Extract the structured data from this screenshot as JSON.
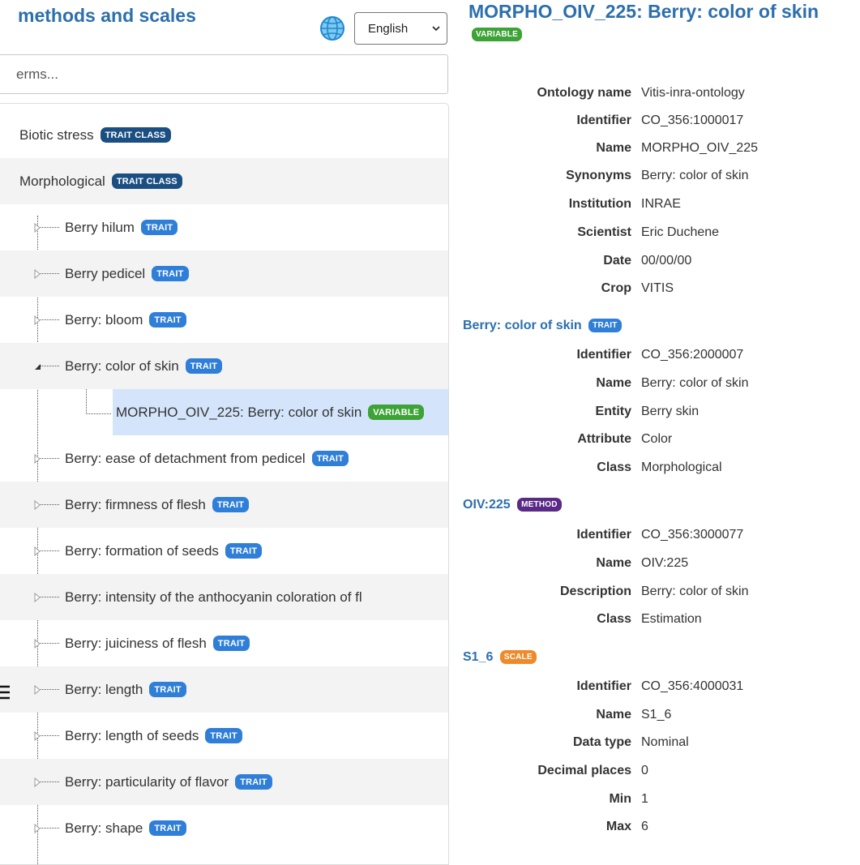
{
  "left": {
    "title": "methods and scales",
    "language": "English",
    "search_placeholder": "erms...",
    "tree": [
      {
        "label": "Biotic stress",
        "badge": "TRAIT CLASS"
      },
      {
        "label": "Morphological",
        "badge": "TRAIT CLASS"
      },
      {
        "label": "Berry hilum",
        "badge": "TRAIT"
      },
      {
        "label": "Berry pedicel",
        "badge": "TRAIT"
      },
      {
        "label": "Berry: bloom",
        "badge": "TRAIT"
      },
      {
        "label": "Berry: color of skin",
        "badge": "TRAIT"
      },
      {
        "label": "MORPHO_OIV_225: Berry: color of skin",
        "badge": "VARIABLE"
      },
      {
        "label": "Berry: ease of detachment from pedicel",
        "badge": "TRAIT"
      },
      {
        "label": "Berry: firmness of flesh",
        "badge": "TRAIT"
      },
      {
        "label": "Berry: formation of seeds",
        "badge": "TRAIT"
      },
      {
        "label": "Berry: intensity of the anthocyanin coloration of fl",
        "badge": ""
      },
      {
        "label": "Berry: juiciness of flesh",
        "badge": "TRAIT"
      },
      {
        "label": "Berry: length",
        "badge": "TRAIT"
      },
      {
        "label": "Berry: length of seeds",
        "badge": "TRAIT"
      },
      {
        "label": "Berry: particularity of flavor",
        "badge": "TRAIT"
      },
      {
        "label": "Berry: shape",
        "badge": "TRAIT"
      }
    ]
  },
  "detail": {
    "title": "MORPHO_OIV_225: Berry: color of skin",
    "title_badge": "VARIABLE",
    "variable": [
      [
        "Ontology name",
        "Vitis-inra-ontology"
      ],
      [
        "Identifier",
        "CO_356:1000017"
      ],
      [
        "Name",
        "MORPHO_OIV_225"
      ],
      [
        "Synonyms",
        "Berry: color of skin"
      ],
      [
        "Institution",
        "INRAE"
      ],
      [
        "Scientist",
        "Eric Duchene"
      ],
      [
        "Date",
        "00/00/00"
      ],
      [
        "Crop",
        "VITIS"
      ]
    ],
    "trait": {
      "title": "Berry: color of skin",
      "badge": "TRAIT",
      "rows": [
        [
          "Identifier",
          "CO_356:2000007"
        ],
        [
          "Name",
          "Berry: color of skin"
        ],
        [
          "Entity",
          "Berry skin"
        ],
        [
          "Attribute",
          "Color"
        ],
        [
          "Class",
          "Morphological"
        ]
      ]
    },
    "method": {
      "title": "OIV:225",
      "badge": "METHOD",
      "rows": [
        [
          "Identifier",
          "CO_356:3000077"
        ],
        [
          "Name",
          "OIV:225"
        ],
        [
          "Description",
          "Berry: color of skin"
        ],
        [
          "Class",
          "Estimation"
        ]
      ]
    },
    "scale": {
      "title": "S1_6",
      "badge": "SCALE",
      "rows": [
        [
          "Identifier",
          "CO_356:4000031"
        ],
        [
          "Name",
          "S1_6"
        ],
        [
          "Data type",
          "Nominal"
        ],
        [
          "Decimal places",
          "0"
        ],
        [
          "Min",
          "1"
        ],
        [
          "Max",
          "6"
        ]
      ]
    }
  },
  "icons": {
    "language": "globe-icon",
    "dropdown": "chevron-down-icon",
    "expander": "triangle-icon"
  },
  "colors": {
    "link": "#2c6fad",
    "trait_class": "#1b4f82",
    "trait": "#2f7ed8",
    "variable": "#3da336",
    "method": "#5a2a86",
    "scale": "#ef8a2b",
    "selected": "#d4e5fb"
  }
}
